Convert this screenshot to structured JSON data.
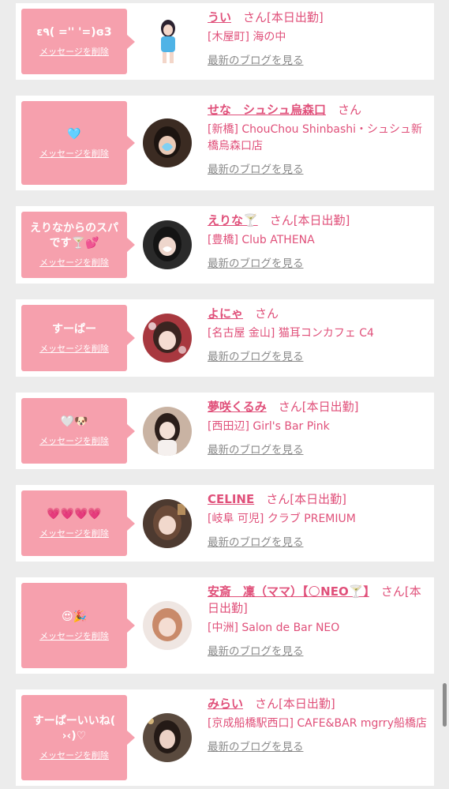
{
  "delete_label": "メッセージを削除",
  "blog_label": "最新のブログを見る",
  "san": "さん",
  "cards": [
    {
      "msg": "ε٩( ='' '=)ɞ3",
      "name": "うい",
      "san_suffix": "さん[本日出勤]",
      "shop": "[木屋町] 海の中"
    },
    {
      "msg": "🩵",
      "name": "せな　シュシュ烏森口",
      "san_suffix": "さん",
      "shop": "[新橋] ChouChou Shinbashi・シュシュ新橋烏森口店"
    },
    {
      "msg": "えりなからのスパです🍸💕",
      "name": "えりな🍸",
      "san_suffix": "さん[本日出勤]",
      "shop": "[豊橋] Club ATHENA"
    },
    {
      "msg": "すーぱー",
      "name": "よにゃ",
      "san_suffix": "さん",
      "shop": "[名古屋 金山] 猫耳コンカフェ C4"
    },
    {
      "msg": "🤍🐶",
      "name": "夢咲くるみ",
      "san_suffix": "さん[本日出勤]",
      "shop": "[西田辺] Girl's Bar Pink"
    },
    {
      "msg": "💗💗💗💗",
      "name": "CELINE",
      "san_suffix": "さん[本日出勤]",
      "shop": "[岐阜 可児] クラブ PREMIUM"
    },
    {
      "msg": "😍🎉",
      "name": "安斎　凜（ママ）【🌕NEO🍸】",
      "san_suffix": "さん[本日出勤]",
      "shop": "[中洲] Salon de Bar NEO"
    },
    {
      "msg": "すーぱーいいね( ›‹)♡",
      "name": "みらい",
      "san_suffix": "さん[本日出勤]",
      "shop": "[京成船橋駅西口] CAFE&BAR mgrry船橋店"
    }
  ]
}
